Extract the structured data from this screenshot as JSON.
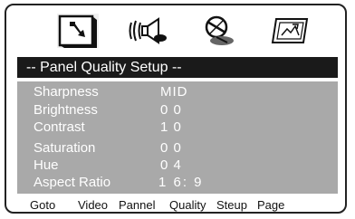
{
  "toolbar": {
    "icons": [
      {
        "name": "general-setup-icon",
        "active": true
      },
      {
        "name": "audio-setup-icon",
        "active": false
      },
      {
        "name": "video-setup-icon",
        "active": false
      },
      {
        "name": "picture-setup-icon",
        "active": false
      }
    ]
  },
  "panel": {
    "title": "-- Panel Quality Setup --",
    "rows": [
      {
        "label": "Sharpness",
        "value": "MID"
      },
      {
        "label": "Brightness",
        "value": "0 0"
      },
      {
        "label": "Contrast",
        "value": "1 0"
      },
      {
        "label": "Saturation",
        "value": "0 0"
      },
      {
        "label": "Hue",
        "value": "0 4"
      },
      {
        "label": "Aspect Ratio",
        "value": "1 6: 9"
      }
    ]
  },
  "status_bar": {
    "words": [
      "Goto",
      "Video",
      "Pannel",
      "Quality",
      "Steup",
      "Page"
    ]
  }
}
